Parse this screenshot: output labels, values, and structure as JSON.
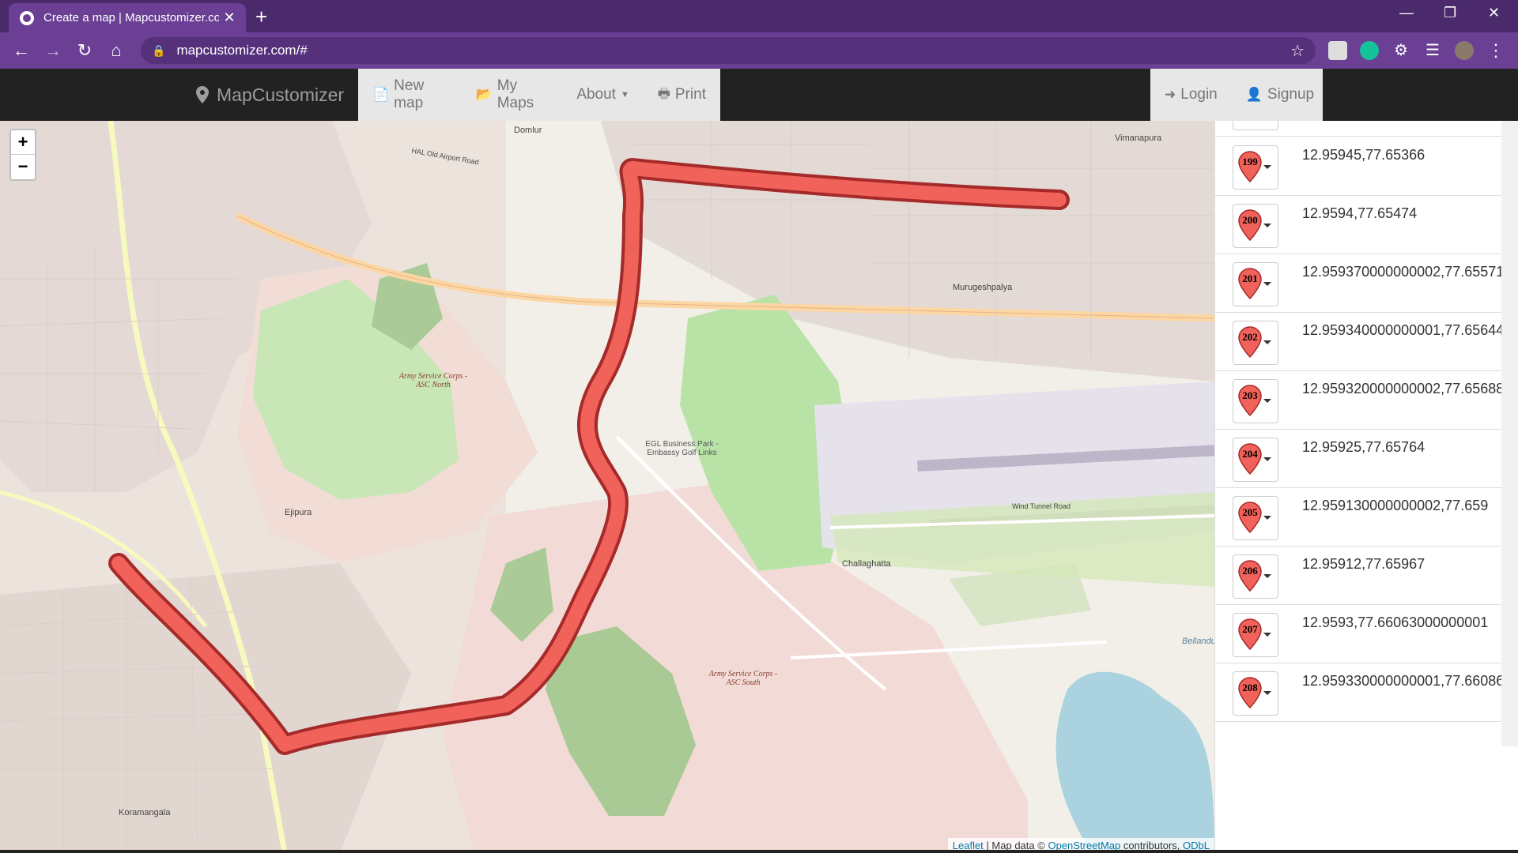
{
  "browser": {
    "tab_title": "Create a map | Mapcustomizer.com",
    "url": "mapcustomizer.com/#",
    "new_tab": "+",
    "close_tab": "✕"
  },
  "site": {
    "brand": "MapCustomizer",
    "nav": {
      "new_map": "New map",
      "my_maps": "My Maps",
      "about": "About",
      "print": "Print",
      "login": "Login",
      "signup": "Signup"
    }
  },
  "map": {
    "zoom_in": "+",
    "zoom_out": "−",
    "labels": {
      "asc_north": "Army Service Corps - ASC North",
      "asc_south": "Army Service Corps - ASC South",
      "egl": "EGL Business Park - Embassy Golf Links",
      "hal": "HAL Old Airport Road",
      "wind_tunnel": "Wind Tunnel Road",
      "challaghatta": "Challaghatta",
      "murugeshpalya": "Murugeshpalya",
      "koramangala": "Koramangala",
      "domlur": "Domlur",
      "vimanapura": "Vimanapura",
      "ejipura": "Ejipura",
      "bellandur": "Bellandur"
    },
    "attribution": {
      "leaflet": "Leaflet",
      "sep": "| Map data ©",
      "osm": "OpenStreetMap",
      "contrib": "contributors,",
      "odbl": "ODbL"
    }
  },
  "markers": [
    {
      "num": "199",
      "coord": "12.95945,77.65366"
    },
    {
      "num": "200",
      "coord": "12.9594,77.65474"
    },
    {
      "num": "201",
      "coord": "12.959370000000002,77.655710"
    },
    {
      "num": "202",
      "coord": "12.959340000000001,77.65644"
    },
    {
      "num": "203",
      "coord": "12.959320000000002,77.65688"
    },
    {
      "num": "204",
      "coord": "12.95925,77.65764"
    },
    {
      "num": "205",
      "coord": "12.959130000000002,77.659"
    },
    {
      "num": "206",
      "coord": "12.95912,77.65967"
    },
    {
      "num": "207",
      "coord": "12.9593,77.66063000000001"
    },
    {
      "num": "208",
      "coord": "12.959330000000001,77.66086"
    }
  ],
  "colors": {
    "marker": "#f0625a",
    "route_outline": "#a52a2a",
    "browser_bar": "#6a3f94",
    "site_bar": "#222222"
  }
}
